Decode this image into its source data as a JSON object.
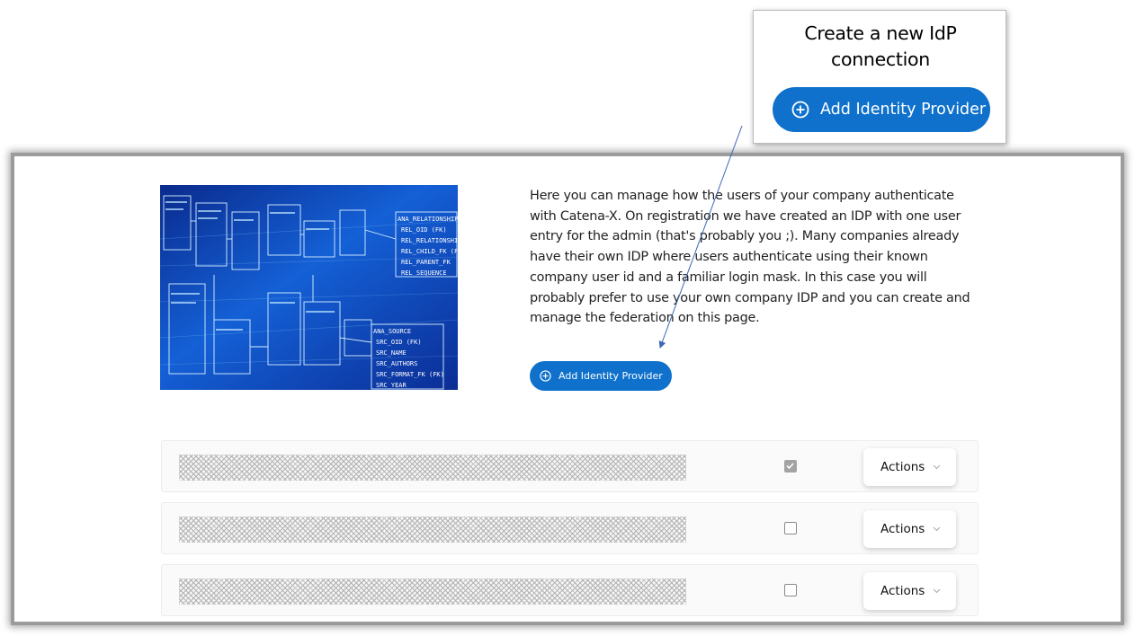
{
  "callout": {
    "title_line1": "Create a new IdP",
    "title_line2": "connection",
    "button_label": "Add Identity Provider"
  },
  "intro": {
    "text": "Here you can manage how the users of your company authenticate with Catena-X. On registration we have created an IDP with one user entry for the admin (that's probably you ;). Many companies already have their own IDP where users authenticate using their known company user id and a familiar login mask. In this case you will probably prefer to use your own company IDP and you can create and manage the federation on this page."
  },
  "add_button": {
    "label": "Add Identity Provider"
  },
  "idp_list": [
    {
      "enabled": true,
      "actions_label": "Actions"
    },
    {
      "enabled": false,
      "actions_label": "Actions"
    },
    {
      "enabled": false,
      "actions_label": "Actions"
    }
  ],
  "hero_image_labels": [
    "ANA_RELATIONSHIP",
    "REL_OID (FK)",
    "REL_RELATIONSHI",
    "REL_CHILD_FK (F",
    "REL_PARENT_FK",
    "REL_SEQUENCE",
    "ANA_SOURCE",
    "SRC_OID (FK)",
    "SRC_NAME",
    "SRC_AUTHORS",
    "SRC_FORMAT_FK (FK)",
    "SRC_YEAR"
  ],
  "colors": {
    "primary": "#0f71cb",
    "frame_border": "#9b9b9b",
    "arrow": "#3f67b5"
  },
  "icons": [
    "plus-circle-icon",
    "checkbox-icon",
    "chevron-down-icon"
  ]
}
